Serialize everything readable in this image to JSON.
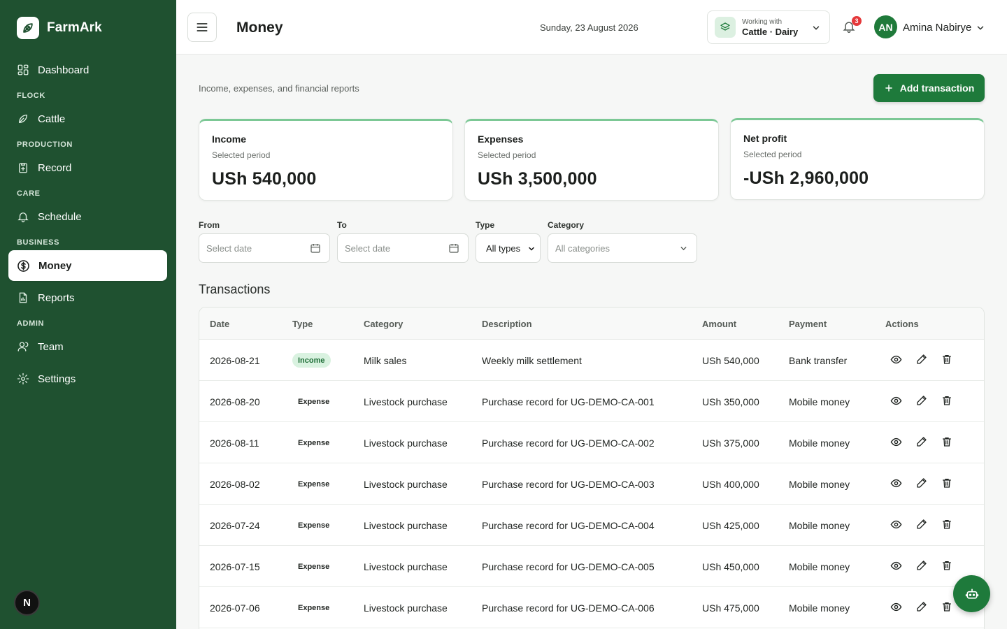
{
  "app": {
    "name": "FarmArk"
  },
  "sidebar": {
    "items": [
      {
        "label": "Dashboard",
        "icon": "dashboard-icon"
      },
      {
        "section": "FLOCK"
      },
      {
        "label": "Cattle",
        "icon": "leaf-icon"
      },
      {
        "section": "PRODUCTION"
      },
      {
        "label": "Record",
        "icon": "clipboard-icon"
      },
      {
        "section": "CARE"
      },
      {
        "label": "Schedule",
        "icon": "bell-icon"
      },
      {
        "section": "BUSINESS"
      },
      {
        "label": "Money",
        "icon": "dollar-icon",
        "active": true
      },
      {
        "label": "Reports",
        "icon": "report-icon"
      },
      {
        "section": "ADMIN"
      },
      {
        "label": "Team",
        "icon": "user-icon"
      },
      {
        "label": "Settings",
        "icon": "gear-icon"
      }
    ],
    "footer_badge": "N"
  },
  "header": {
    "title": "Money",
    "date": "Sunday, 23 August 2026",
    "context_label": "Working with",
    "context_value": "Cattle · Dairy",
    "notifications": "3",
    "user_initials": "AN",
    "user_name": "Amina Nabirye"
  },
  "main": {
    "subtitle": "Income, expenses, and financial reports",
    "add_button": "Add transaction",
    "cards": [
      {
        "label": "Income",
        "sub": "Selected period",
        "value": "USh 540,000"
      },
      {
        "label": "Expenses",
        "sub": "Selected period",
        "value": "USh 3,500,000"
      },
      {
        "label": "Net profit",
        "sub": "Selected period",
        "value": "-USh 2,960,000"
      }
    ],
    "filters": {
      "from_label": "From",
      "from_placeholder": "Select date",
      "to_label": "To",
      "to_placeholder": "Select date",
      "type_label": "Type",
      "type_value": "All types",
      "category_label": "Category",
      "category_value": "All categories"
    },
    "transactions_title": "Transactions",
    "columns": [
      "Date",
      "Type",
      "Category",
      "Description",
      "Amount",
      "Payment",
      "Actions"
    ],
    "rows": [
      {
        "date": "2026-08-21",
        "type": "Income",
        "category": "Milk sales",
        "description": "Weekly milk settlement",
        "amount": "USh 540,000",
        "payment": "Bank transfer"
      },
      {
        "date": "2026-08-20",
        "type": "Expense",
        "category": "Livestock purchase",
        "description": "Purchase record for UG-DEMO-CA-001",
        "amount": "USh 350,000",
        "payment": "Mobile money"
      },
      {
        "date": "2026-08-11",
        "type": "Expense",
        "category": "Livestock purchase",
        "description": "Purchase record for UG-DEMO-CA-002",
        "amount": "USh 375,000",
        "payment": "Mobile money"
      },
      {
        "date": "2026-08-02",
        "type": "Expense",
        "category": "Livestock purchase",
        "description": "Purchase record for UG-DEMO-CA-003",
        "amount": "USh 400,000",
        "payment": "Mobile money"
      },
      {
        "date": "2026-07-24",
        "type": "Expense",
        "category": "Livestock purchase",
        "description": "Purchase record for UG-DEMO-CA-004",
        "amount": "USh 425,000",
        "payment": "Mobile money"
      },
      {
        "date": "2026-07-15",
        "type": "Expense",
        "category": "Livestock purchase",
        "description": "Purchase record for UG-DEMO-CA-005",
        "amount": "USh 450,000",
        "payment": "Mobile money"
      },
      {
        "date": "2026-07-06",
        "type": "Expense",
        "category": "Livestock purchase",
        "description": "Purchase record for UG-DEMO-CA-006",
        "amount": "USh 475,000",
        "payment": "Mobile money"
      }
    ]
  },
  "colors": {
    "sidebar": "#1f5130",
    "accent": "#1e7a3b",
    "card_top": "#7cc895",
    "income_badge": "#d9f2e0"
  }
}
